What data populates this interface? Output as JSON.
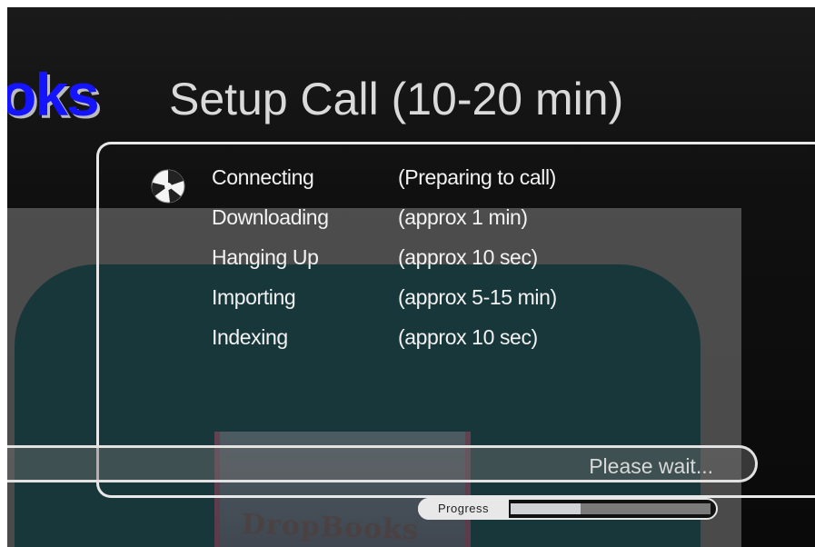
{
  "brand": {
    "text": "oks",
    "color": "#1414ff"
  },
  "header": {
    "title": "Setup Call (10-20 min)"
  },
  "steps": [
    {
      "name": "Connecting",
      "detail": "(Preparing to call)",
      "active": true
    },
    {
      "name": "Downloading",
      "detail": "(approx 1 min)",
      "active": false
    },
    {
      "name": "Hanging Up",
      "detail": "(approx 10 sec)",
      "active": false
    },
    {
      "name": "Importing",
      "detail": "(approx 5-15 min)",
      "active": false
    },
    {
      "name": "Indexing",
      "detail": "(approx 10 sec)",
      "active": false
    }
  ],
  "active_step_icon": "spinner-icon",
  "status": {
    "text": "Please wait..."
  },
  "progress": {
    "label": "Progress",
    "fraction": 0.35
  },
  "watermark": {
    "text": "DropBooks"
  },
  "colors": {
    "background": "#0e0e0e",
    "text": "#f2f2f2",
    "teal_overlay": "#0a3237"
  }
}
